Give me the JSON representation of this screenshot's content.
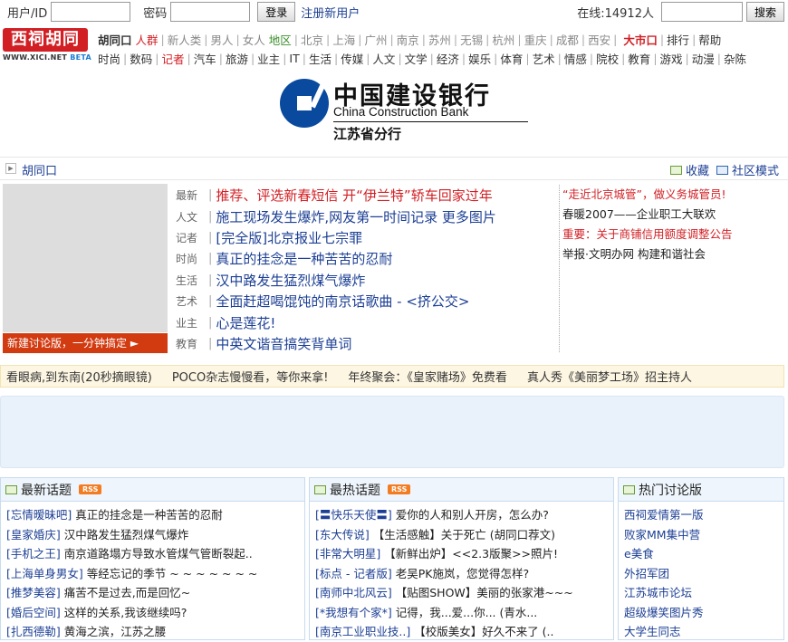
{
  "login": {
    "user_label": "用户/ID",
    "password_label": "密码",
    "login_button": "登录",
    "register_link": "注册新用户",
    "online_label": "在线:14912人",
    "search_button": "搜索"
  },
  "logo": {
    "text": "西祠胡同",
    "url": "WWW.XICI.NET",
    "beta": "BETA"
  },
  "nav1": {
    "home": "胡同口",
    "people": "人群",
    "groups": [
      "新人类",
      "男人",
      "女人"
    ],
    "region_label": "地区",
    "cities": [
      "北京",
      "上海",
      "广州",
      "南京",
      "苏州",
      "无锡",
      "杭州",
      "重庆",
      "成都",
      "西安"
    ],
    "market": "大市口",
    "rank": "排行",
    "help": "帮助"
  },
  "nav2": [
    "时尚",
    "数码",
    "记者",
    "汽车",
    "旅游",
    "业主",
    "IT",
    "生活",
    "传媒",
    "人文",
    "文学",
    "经济",
    "娱乐",
    "体育",
    "艺术",
    "情感",
    "院校",
    "教育",
    "游戏",
    "动漫",
    "杂陈"
  ],
  "banner": {
    "cn": "中国建设银行",
    "en": "China Construction Bank",
    "branch": "江苏省分行"
  },
  "crumb": {
    "current": "胡同口",
    "favorite": "收藏",
    "community": "社区模式"
  },
  "featured": {
    "button": "新建讨论版，一分钟搞定 ►",
    "items": [
      {
        "cat": "最新",
        "text": "推荐、评选新春短信 开“伊兰特”轿车回家过年"
      },
      {
        "cat": "人文",
        "text": "施工现场发生爆炸,网友第一时间记录 更多图片"
      },
      {
        "cat": "记者",
        "text": "[完全版]北京报业七宗罪"
      },
      {
        "cat": "时尚",
        "text": "真正的挂念是一种苦苦的忍耐"
      },
      {
        "cat": "生活",
        "text": "汉中路发生猛烈煤气爆炸"
      },
      {
        "cat": "艺术",
        "text": "全面赶超喝馄饨的南京话歌曲 - <挤公交>"
      },
      {
        "cat": "业主",
        "text": "心是莲花!"
      },
      {
        "cat": "教育",
        "text": "中英文谐音搞笑背单词"
      }
    ]
  },
  "notes": [
    "“走近北京城管”，做义务城管员!",
    "春暖2007——企业职工大联欢",
    "重要：关于商铺信用额度调整公告",
    "举报·文明办网 构建和谐社会"
  ],
  "ticker": [
    "看眼病,到东南(20秒摘眼镜)",
    "POCO杂志慢慢看，等你来拿!",
    "年终聚会：《皇家赌场》免费看",
    "真人秀《美丽梦工场》招主持人"
  ],
  "latest": {
    "title": "最新话题",
    "rss": "RSS",
    "rows": [
      {
        "tag": "[忘情暧昧吧]",
        "title": "真正的挂念是一种苦苦的忍耐"
      },
      {
        "tag": "[皇家婚庆]",
        "title": "汉中路发生猛烈煤气爆炸"
      },
      {
        "tag": "[手机之王]",
        "title": "南京道路塌方导致水管煤气管断裂起.."
      },
      {
        "tag": "[上海单身男女]",
        "title": "等经忘记的季节 ~ ~ ~ ~ ~ ~ ~"
      },
      {
        "tag": "[推梦美容]",
        "title": "痛苦不是过去,而是回忆~"
      },
      {
        "tag": "[婚后空间]",
        "title": "这样的关系,我该继续吗?"
      },
      {
        "tag": "[扎西德勒]",
        "title": "黄海之滨，江苏之腰"
      }
    ]
  },
  "hottest": {
    "title": "最热话题",
    "rss": "RSS",
    "rows": [
      {
        "tag": "[〓快乐天使〓]",
        "title": "爱你的人和别人开房，怎么办?"
      },
      {
        "tag": "[东大传说]",
        "title": "【生活感触】关于死亡 (胡同口荐文)"
      },
      {
        "tag": "[非常大明星]",
        "title": "【新鲜出炉】<<2.3版聚>>照片!"
      },
      {
        "tag": "[标点 - 记者版]",
        "title": "老吴PK施岚，您觉得怎样?"
      },
      {
        "tag": "[南师中北风云]",
        "title": "【贴图SHOW】美丽的张家港~~~"
      },
      {
        "tag": "[*我想有个家*]",
        "title": "记得，我...爱...你... (青水..."
      },
      {
        "tag": "[南京工业职业技..]",
        "title": "【校版美女】好久不来了 (.."
      }
    ]
  },
  "hotboards": {
    "title": "热门讨论版",
    "rows": [
      "西祠爱情第一版",
      "败家MM集中营",
      "e美食",
      "外招军团",
      "江苏城市论坛",
      "超级爆笑图片秀",
      "大学生同志"
    ]
  },
  "colors": {
    "accent": "#d21f24",
    "link": "#1c3f94",
    "ccb_blue": "#0a4a9e"
  }
}
